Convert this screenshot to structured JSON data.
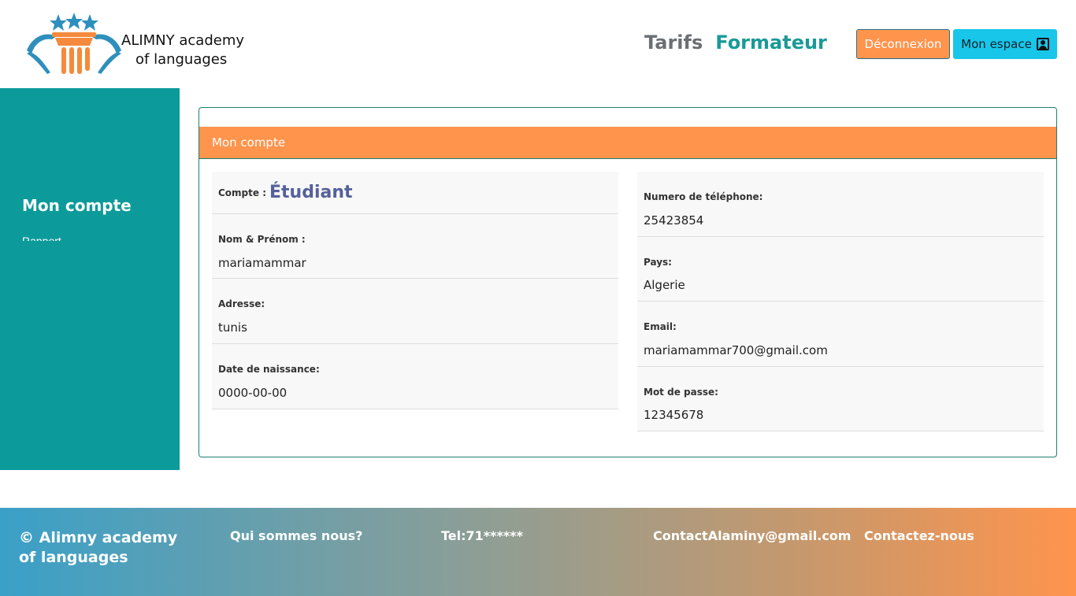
{
  "header": {
    "brand_line1": "ALIMNY academy",
    "brand_line2": "of languages",
    "nav": {
      "tarifs": "Tarifs",
      "formateur": "Formateur"
    },
    "logout_label": "Déconnexion",
    "space_label": "Mon espace"
  },
  "sidebar": {
    "title": "Mon compte",
    "item": "Rapport"
  },
  "card": {
    "title": "Mon compte",
    "left": {
      "account_label": "Compte :",
      "account_type": "Étudiant",
      "name_label": "Nom & Prénom :",
      "name_value": "mariamammar",
      "address_label": "Adresse:",
      "address_value": "tunis",
      "birth_label": "Date de naissance:",
      "birth_value": "0000-00-00"
    },
    "right": {
      "phone_label": "Numero de téléphone:",
      "phone_value": "25423854",
      "country_label": "Pays:",
      "country_value": "Algerie",
      "email_label": "Email:",
      "email_value": "mariamammar700@gmail.com",
      "password_label": "Mot de passe:",
      "password_value": "12345678"
    }
  },
  "footer": {
    "copyright": "© Alimny academy of languages",
    "about": "Qui sommes nous?",
    "tel": "Tel:71******",
    "email": "ContactAlaminy@gmail.com",
    "contact": "Contactez-nous"
  },
  "colors": {
    "teal": "#0c9a9a",
    "orange": "#ff944d",
    "cyan": "#18c6ea",
    "account_type": "#55619a"
  }
}
